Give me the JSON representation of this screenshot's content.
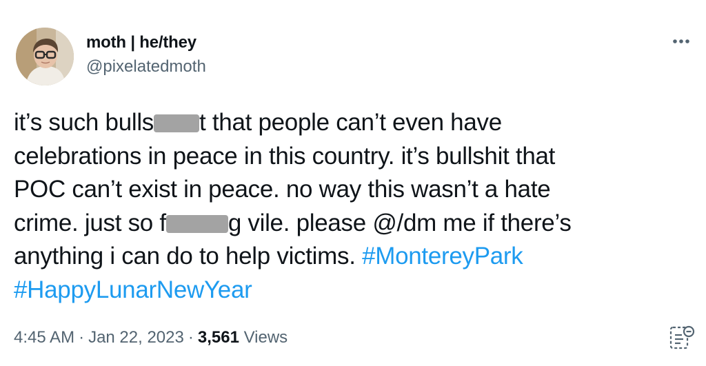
{
  "author": {
    "display_name": "moth | he/they",
    "handle": "@pixelatedmoth"
  },
  "tweet": {
    "lines": [
      {
        "a": "it’s such bulls",
        "b": "t that people can’t even have"
      },
      {
        "text": "celebrations in peace in this country. it’s bullshit that"
      },
      {
        "text": "POC can’t exist in peace. no way this wasn’t a hate"
      },
      {
        "a": "crime. just so f",
        "b": "g vile. please @/dm me if there’s"
      },
      {
        "text": "anything i can do to help victims. ",
        "hashtag": "#MontereyPark"
      },
      {
        "hashtag": "#HappyLunarNewYear"
      }
    ]
  },
  "meta": {
    "time": "4:45 AM",
    "dot1": "·",
    "date": "Jan 22, 2023",
    "dot2": "·",
    "views_count": "3,561",
    "views_label": "Views"
  },
  "icons": {
    "more": "more-options-icon",
    "analytics": "analytics-icon"
  },
  "colors": {
    "text": "#0f1419",
    "secondary": "#536471",
    "link": "#1d9bf0",
    "redaction": "#a3a3a3"
  }
}
